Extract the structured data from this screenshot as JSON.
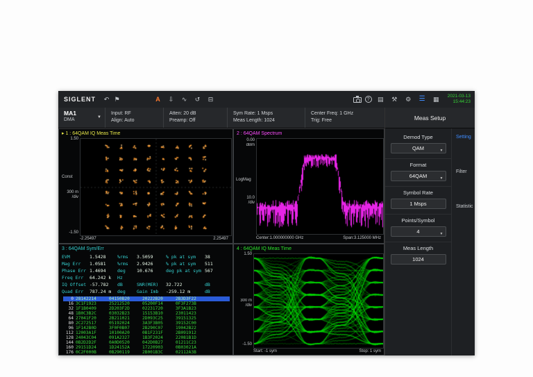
{
  "app": {
    "brand": "SIGLENT",
    "clock": {
      "date": "2021-03-13",
      "time": "15:44:23"
    }
  },
  "toolbar": {
    "icons": {
      "undo": "↶",
      "flag": "⚑",
      "auto": "A",
      "save": "⇩",
      "signal": "∿",
      "history": "↺",
      "display": "⊟",
      "help": "?",
      "file": "▤",
      "tools": "⚒",
      "settings": "⚙",
      "menu": "☰",
      "apps": "▦"
    }
  },
  "statusbar": {
    "mode": "MA1",
    "submode": "DMA",
    "caret": "▼",
    "fields": [
      {
        "l1": "Input: RF",
        "l2": "Align: Auto"
      },
      {
        "l1": "Atten: 20 dB",
        "l2": "Preamp: Off"
      },
      {
        "l1": "Sym Rate: 1 Msps",
        "l2": "Meas Length: 1024"
      },
      {
        "l1": "Center Freq: 1 GHz",
        "l2": "Trig: Free"
      }
    ]
  },
  "sidebar": {
    "title": "Meas Setup",
    "groups": [
      {
        "label": "Demod Type",
        "value": "QAM",
        "caret": "▼"
      },
      {
        "label": "Format",
        "value": "64QAM",
        "caret": "▼"
      },
      {
        "label": "Symbol Rate",
        "value": "1 Msps",
        "caret": ""
      },
      {
        "label": "Points/Symbol",
        "value": "4",
        "caret": "▼"
      },
      {
        "label": "Meas Length",
        "value": "1024",
        "caret": ""
      }
    ],
    "tabs": [
      {
        "label": "Setting"
      },
      {
        "label": "Filter"
      },
      {
        "label": "Statistic"
      }
    ]
  },
  "win1": {
    "marker": "▸",
    "title": "1 : 64QAM  IQ Meas Time",
    "y_top": "1.50",
    "y_bottom": "-1.50",
    "axis": "Const",
    "scale1": "300 m",
    "scale2": "/div",
    "x_left": "-2.25497",
    "x_right": "2.25497",
    "trace_color": "#ff9a2e"
  },
  "win2": {
    "title": "2 : 64QAM  Spectrum",
    "ref1": "0.00",
    "ref2": "dBm",
    "axis": "LogMag",
    "scale1": "10.0",
    "scale2": "/div",
    "center": "Center:1.000000000 GHz",
    "span": "Span:3.125000 MHz",
    "trace_color": "#ff28ff"
  },
  "win3": {
    "title": "3 : 64QAM  Sym/Err",
    "metrics": [
      [
        {
          "t": "EVM",
          "k": "l"
        },
        {
          "t": "1.5428",
          "k": "v"
        },
        {
          "t": "%rms",
          "k": "l"
        },
        {
          "t": "3.5059",
          "k": "v"
        },
        {
          "t": "% pk at sym",
          "k": "l"
        },
        {
          "t": "38",
          "k": "v"
        }
      ],
      [
        {
          "t": "Mag Err",
          "k": "l"
        },
        {
          "t": "1.0581",
          "k": "v"
        },
        {
          "t": "%rms",
          "k": "l"
        },
        {
          "t": "2.9426",
          "k": "v"
        },
        {
          "t": "% pk at sym",
          "k": "l"
        },
        {
          "t": "511",
          "k": "v"
        }
      ],
      [
        {
          "t": "Phase Err",
          "k": "l"
        },
        {
          "t": "1.4694",
          "k": "v"
        },
        {
          "t": "deg",
          "k": "l"
        },
        {
          "t": "10.676",
          "k": "v"
        },
        {
          "t": "deg pk at sym",
          "k": "l"
        },
        {
          "t": "567",
          "k": "v"
        }
      ],
      [
        {
          "t": "Freq Err",
          "k": "l"
        },
        {
          "t": "64.242 k",
          "k": "v"
        },
        {
          "t": "Hz",
          "k": "l"
        },
        {
          "t": "",
          "k": "v"
        },
        {
          "t": "",
          "k": "l"
        },
        {
          "t": "",
          "k": "v"
        }
      ],
      [
        {
          "t": "IQ Offset",
          "k": "l"
        },
        {
          "t": "-57.782",
          "k": "v"
        },
        {
          "t": "dB",
          "k": "l"
        },
        {
          "t": "SNR(MER)",
          "k": "l"
        },
        {
          "t": "32.722",
          "k": "v"
        },
        {
          "t": "dB",
          "k": "l"
        }
      ],
      [
        {
          "t": "Quad Err",
          "k": "l"
        },
        {
          "t": "787.24 m",
          "k": "v"
        },
        {
          "t": "deg",
          "k": "l"
        },
        {
          "t": "Gain Imb",
          "k": "l"
        },
        {
          "t": "-259.12 m",
          "k": "v"
        },
        {
          "t": "dB",
          "k": "l"
        }
      ]
    ],
    "hex": [
      {
        "idx": "0",
        "g": [
          "28142214",
          "04150B20",
          "20222B20",
          "2B3D3F22"
        ],
        "sel": true
      },
      {
        "idx": "16",
        "g": [
          "3C1F1923",
          "25212520",
          "05200F14",
          "0F3F273B"
        ],
        "sel": false
      },
      {
        "idx": "32",
        "g": [
          "1F1B0409",
          "2D203F2D",
          "02231720",
          "3F3A1B23"
        ],
        "sel": false
      },
      {
        "idx": "48",
        "g": [
          "1B0C3B2C",
          "03032B23",
          "15153B10",
          "23011423"
        ],
        "sel": false
      },
      {
        "idx": "64",
        "g": [
          "27041F20",
          "2B211021",
          "2D093C25",
          "39151325"
        ],
        "sel": false
      },
      {
        "idx": "80",
        "g": [
          "2C272517",
          "05192024",
          "3A3F3B05",
          "39152C00"
        ],
        "sel": false
      },
      {
        "idx": "96",
        "g": [
          "1F142B0D",
          "3F0F0B07",
          "2B290C07",
          "19042B22"
        ],
        "sel": false
      },
      {
        "idx": "112",
        "g": [
          "12003A1F",
          "10100A20",
          "0B1F231F",
          "2B091912"
        ],
        "sel": false
      },
      {
        "idx": "128",
        "g": [
          "24043C04",
          "091A2327",
          "1B3F2024",
          "22081B1D"
        ],
        "sel": false
      },
      {
        "idx": "144",
        "g": [
          "0B2D2D2F",
          "0A0D0520",
          "042D0B27",
          "01211C23"
        ],
        "sel": false
      },
      {
        "idx": "160",
        "g": [
          "29151D24",
          "1D24152A",
          "17220903",
          "0B03021A"
        ],
        "sel": false
      },
      {
        "idx": "176",
        "g": [
          "0C2F000B",
          "0B290119",
          "2B001B3C",
          "02112A3B"
        ],
        "sel": false
      }
    ]
  },
  "win4": {
    "title": "4 : 64QAM  IQ Meas Time",
    "y_top": "1.50",
    "y_bottom": "-1.50",
    "scale1": "300 m",
    "scale2": "/div",
    "x_left": "Start: -1 sym",
    "x_right": "Stop: 1 sym",
    "trace_color": "#00eb00"
  }
}
